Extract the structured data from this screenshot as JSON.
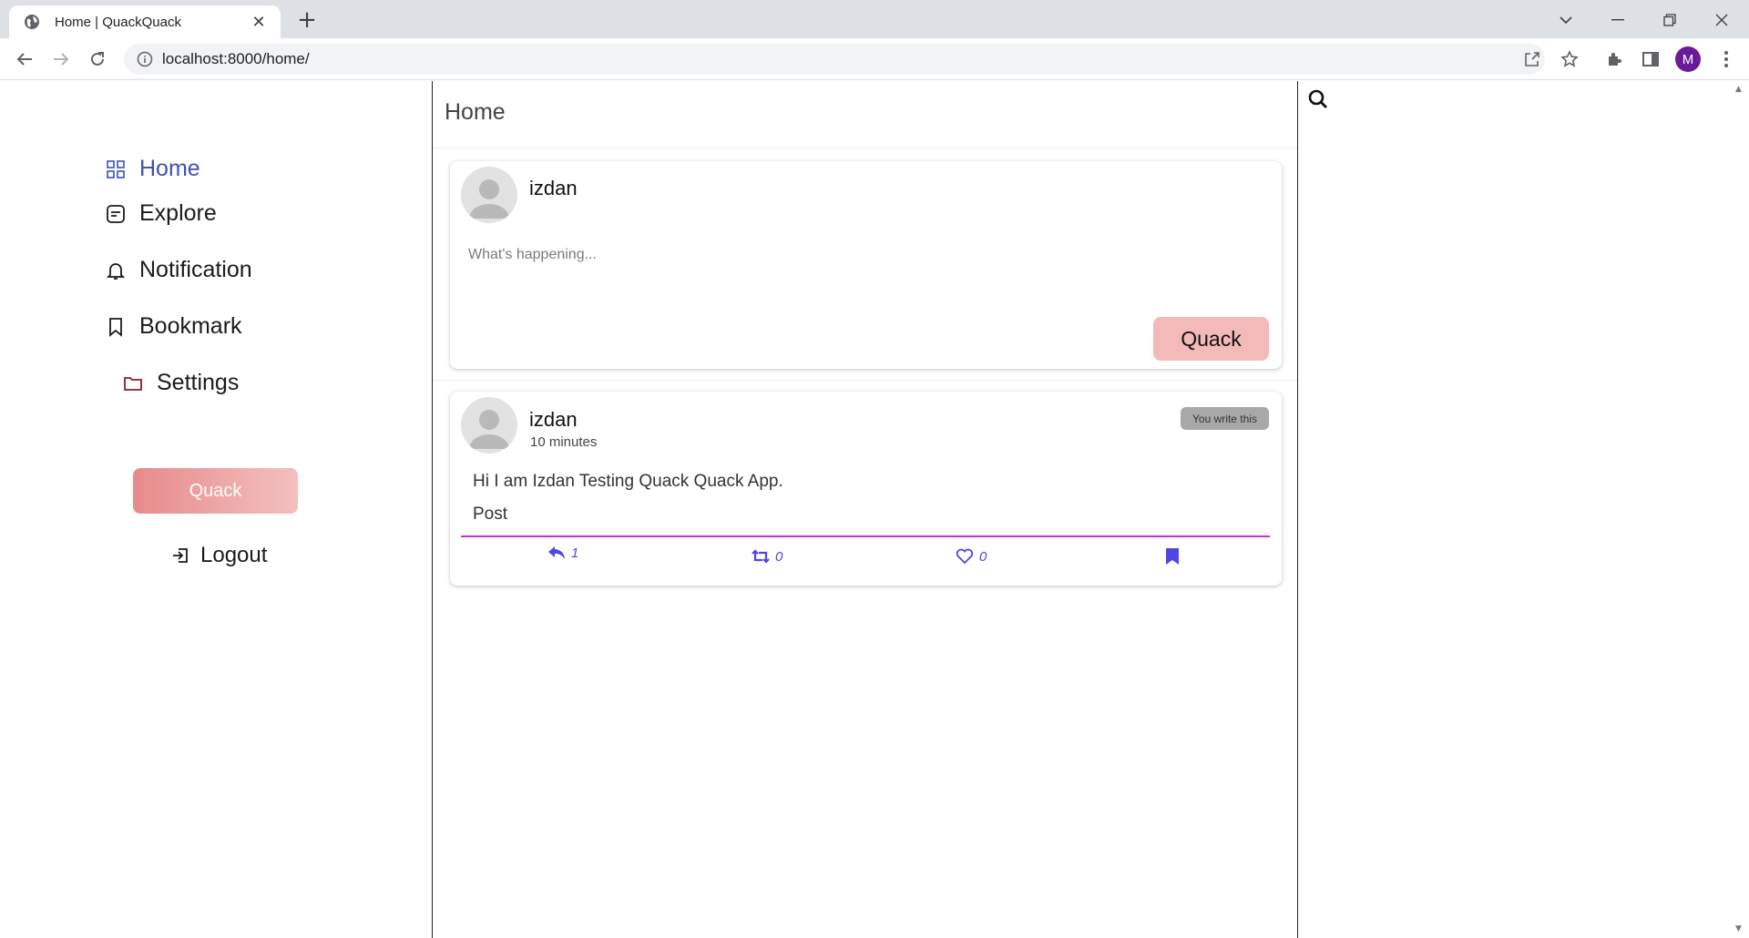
{
  "browser": {
    "tab_title": "Home | QuackQuack",
    "url": "localhost:8000/home/",
    "profile_initial": "M"
  },
  "sidebar": {
    "items": [
      {
        "label": "Home",
        "icon": "grid-icon",
        "active": true
      },
      {
        "label": "Explore",
        "icon": "note-icon"
      },
      {
        "label": "Notification",
        "icon": "bell-icon"
      },
      {
        "label": "Bookmark",
        "icon": "bookmark-icon"
      },
      {
        "label": "Settings",
        "icon": "folder-icon"
      }
    ],
    "quack_button": "Quack",
    "logout": "Logout"
  },
  "feed": {
    "title": "Home",
    "composer": {
      "username": "izdan",
      "placeholder": "What's happening...",
      "submit": "Quack"
    },
    "posts": [
      {
        "username": "izdan",
        "time": "10 minutes",
        "badge": "You write this",
        "text": "Hi I am Izdan Testing Quack Quack App.",
        "type": "Post",
        "replies": "1",
        "requacks": "0",
        "likes": "0"
      }
    ]
  },
  "colors": {
    "accent": "#3f51b5",
    "action": "#4f46e5",
    "quack_pink": "#f4b9b9",
    "post_divider": "#c130d6"
  }
}
